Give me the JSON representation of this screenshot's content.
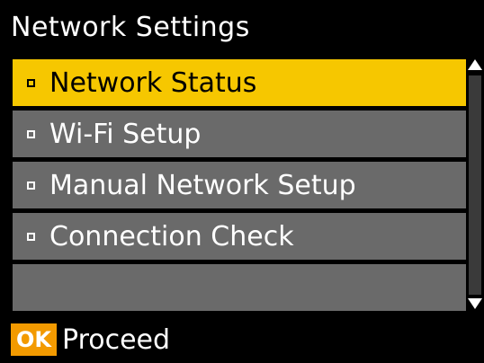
{
  "title": "Network Settings",
  "menu": {
    "items": [
      {
        "label": "Network Status",
        "selected": true
      },
      {
        "label": "Wi-Fi Setup",
        "selected": false
      },
      {
        "label": "Manual Network Setup",
        "selected": false
      },
      {
        "label": "Connection Check",
        "selected": false
      },
      {
        "label": "",
        "selected": false
      }
    ]
  },
  "scrollbar": {
    "up_icon": "arrow-up-icon",
    "down_icon": "arrow-down-icon"
  },
  "footer": {
    "ok_label": "OK",
    "proceed_label": "Proceed"
  },
  "colors": {
    "selected_bg": "#f6c700",
    "item_bg": "#6a6a6a",
    "header_bg": "#000000"
  }
}
